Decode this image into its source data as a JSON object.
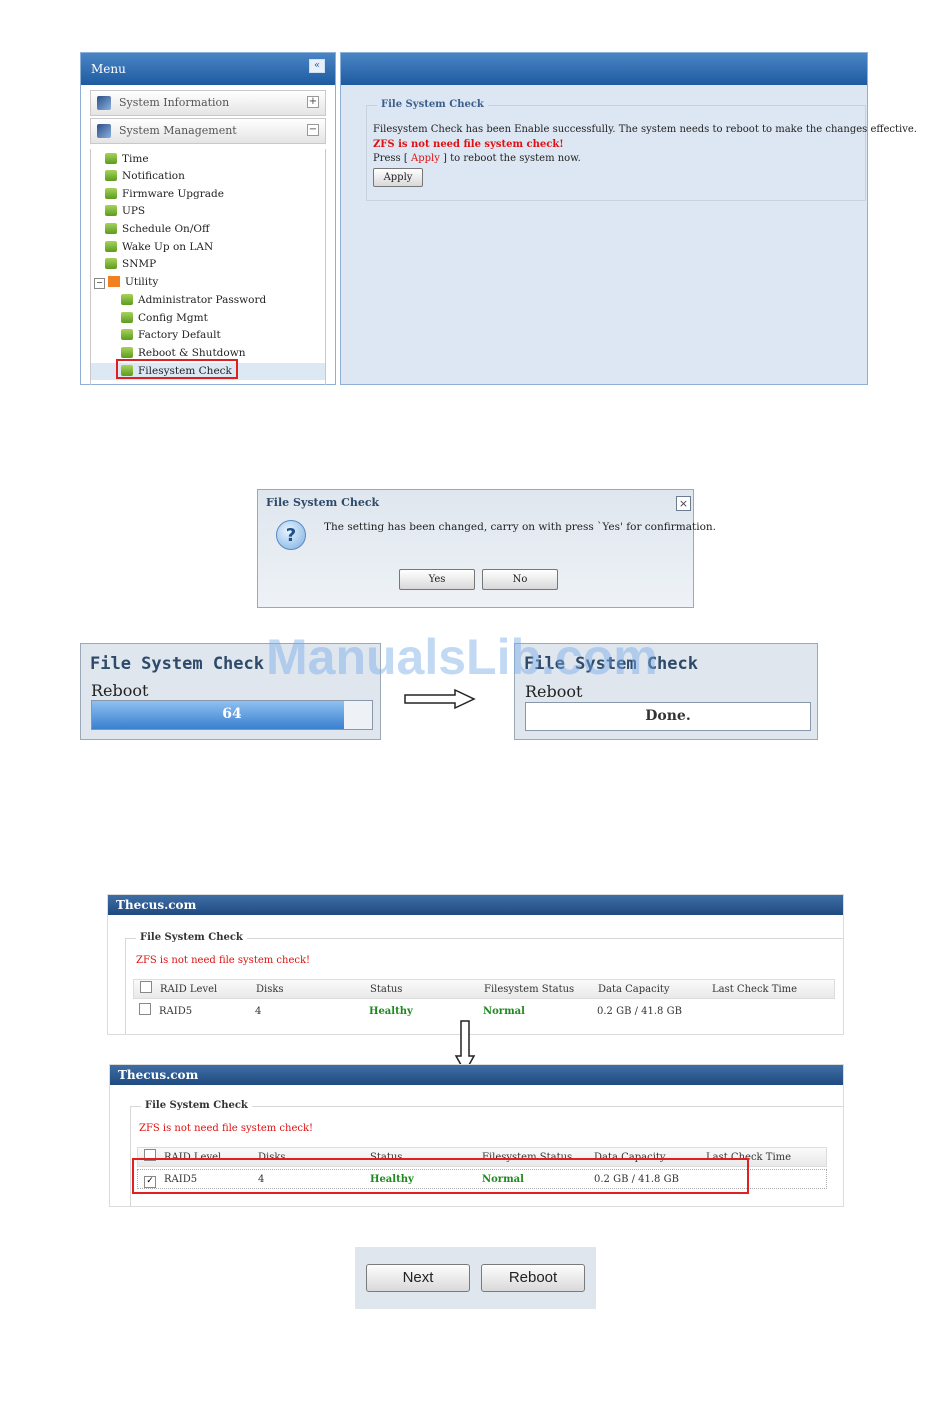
{
  "menu": {
    "title": "Menu",
    "collapse_glyph": "«",
    "sections": [
      {
        "label": "System Information",
        "toggle": "+"
      },
      {
        "label": "System Management",
        "toggle": "−"
      }
    ],
    "items": [
      "Time",
      "Notification",
      "Firmware Upgrade",
      "UPS",
      "Schedule On/Off",
      "Wake Up on LAN",
      "SNMP"
    ],
    "utility": {
      "label": "Utility",
      "items": [
        "Administrator Password",
        "Config Mgmt",
        "Factory Default",
        "Reboot & Shutdown",
        "Filesystem Check"
      ]
    }
  },
  "content": {
    "legend": "File System Check",
    "message": "Filesystem Check has been Enable successfully. The system needs to reboot to make the changes effective.",
    "zfs_warning": "ZFS is not need file system check!",
    "press_prefix": "Press [",
    "press_link": "Apply",
    "press_suffix": "] to reboot the system now.",
    "apply_button": "Apply"
  },
  "dialog": {
    "title": "File System Check",
    "close_glyph": "×",
    "icon_glyph": "?",
    "message": "The setting has been changed, carry on with press `Yes' for confirmation.",
    "yes": "Yes",
    "no": "No"
  },
  "reboot_progress": {
    "title": "File System Check",
    "label": "Reboot",
    "value": "64",
    "progress_fraction": 0.9
  },
  "reboot_done": {
    "title": "File System Check",
    "label": "Reboot",
    "value": "Done."
  },
  "watermark": "ManualsLib.com",
  "thecus_tables": [
    {
      "brand": "Thecus.com",
      "legend": "File System Check",
      "warning": "ZFS is not need file system check!",
      "columns": [
        "RAID Level",
        "Disks",
        "Status",
        "Filesystem Status",
        "Data Capacity",
        "Last Check Time"
      ],
      "row": {
        "raid": "RAID5",
        "disks": "4",
        "status": "Healthy",
        "fs_status": "Normal",
        "capacity": "0.2 GB / 41.8 GB",
        "last_check": "",
        "checked": false
      }
    },
    {
      "brand": "Thecus.com",
      "legend": "File System Check",
      "warning": "ZFS is not need file system check!",
      "columns": [
        "RAID Level",
        "Disks",
        "Status",
        "Filesystem Status",
        "Data Capacity",
        "Last Check Time"
      ],
      "row": {
        "raid": "RAID5",
        "disks": "4",
        "status": "Healthy",
        "fs_status": "Normal",
        "capacity": "0.2 GB / 41.8 GB",
        "last_check": "",
        "checked": true
      }
    }
  ],
  "buttons": {
    "next": "Next",
    "reboot": "Reboot"
  },
  "colors": {
    "accent": "#1e5aa0",
    "warning": "#e01010",
    "healthy": "#1e8a1e",
    "highlight": "#e02020"
  }
}
